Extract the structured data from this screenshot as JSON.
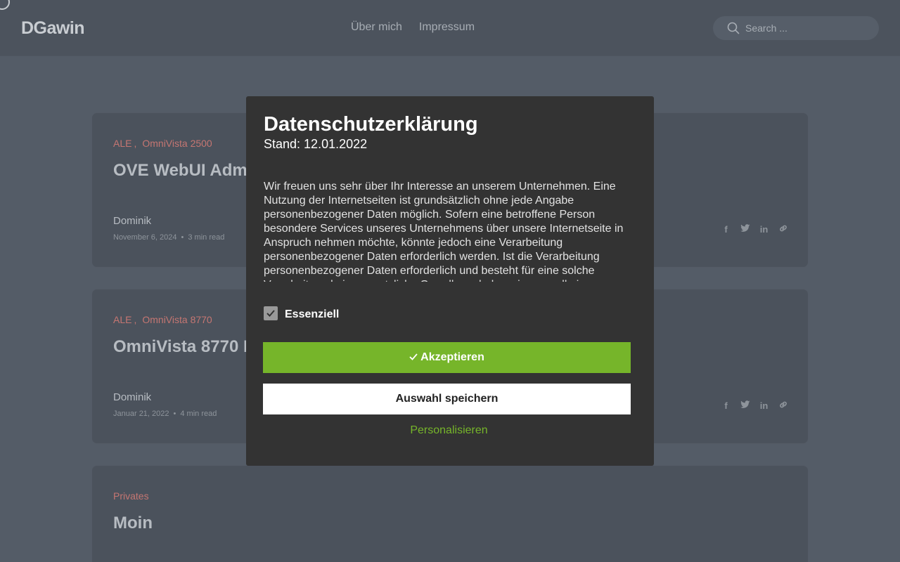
{
  "header": {
    "logo": "DGawin",
    "nav": [
      "Über mich",
      "Impressum"
    ],
    "search_placeholder": "Search ..."
  },
  "posts": [
    {
      "tags": [
        "ALE",
        "OmniVista 2500"
      ],
      "title": "OVE WebUI Admi",
      "author": "Dominik",
      "date": "November 6, 2024",
      "read_time": "3 min read"
    },
    {
      "tags": [
        "ALE",
        "OmniVista 8770"
      ],
      "title": "OmniVista 8770 I",
      "author": "Dominik",
      "date": "Januar 21, 2022",
      "read_time": "4 min read"
    },
    {
      "tags": [
        "Privates"
      ],
      "title": "Moin"
    }
  ],
  "share_icons": [
    "facebook-icon",
    "twitter-icon",
    "linkedin-icon",
    "link-icon"
  ],
  "modal": {
    "title": "Datenschutzerklärung",
    "subtitle": "Stand: 12.01.2022",
    "body": "Wir freuen uns sehr über Ihr Interesse an unserem Unternehmen. Eine Nutzung der Internetseiten ist grundsätzlich ohne jede Angabe personenbezogener Daten möglich. Sofern eine betroffene Person besondere Services unseres Unternehmens über unsere Internetseite in Anspruch nehmen möchte, könnte jedoch eine Verarbeitung personenbezogener Daten erforderlich werden. Ist die Verarbeitung personenbezogener Daten erforderlich und besteht für eine solche Verarbeitung keine gesetzliche Grundlage, holen wir generell eine",
    "checkbox_label": "Essenziell",
    "checkbox_checked": true,
    "accept_label": "Akzeptieren",
    "save_label": "Auswahl speichern",
    "personalize_label": "Personalisieren"
  },
  "colors": {
    "accent_green": "#76b52a",
    "tag_red": "#c57672",
    "modal_bg": "#333333"
  }
}
